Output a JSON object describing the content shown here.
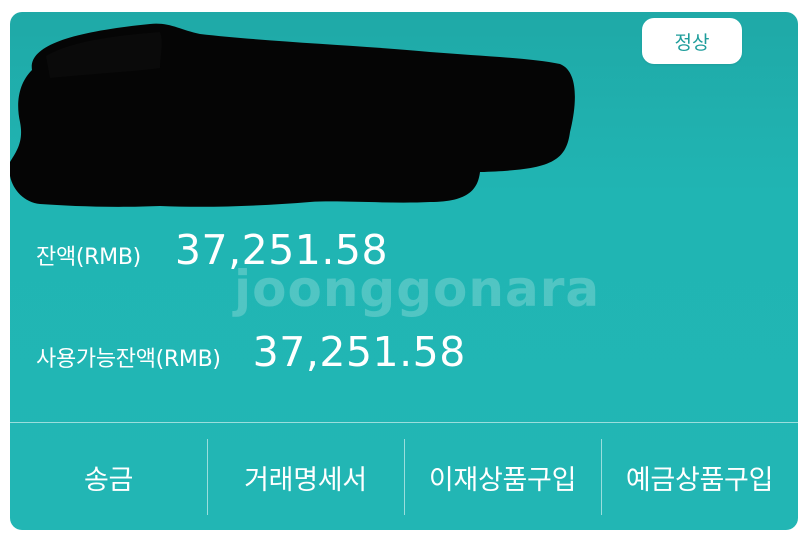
{
  "account": {
    "status": "정상",
    "balance_label": "잔액(RMB)",
    "balance_value": "37,251.58",
    "available_label": "사용가능잔액(RMB)",
    "available_value": "37,251.58"
  },
  "watermark": {
    "text": "joonggonara"
  },
  "actions": [
    {
      "label": "송금"
    },
    {
      "label": "거래명세서"
    },
    {
      "label": "이재상품구입"
    },
    {
      "label": "예금상품구입"
    }
  ],
  "colors": {
    "card_bg": "#20b5b3",
    "badge_text": "#1e9d9b",
    "text": "#ffffff"
  }
}
